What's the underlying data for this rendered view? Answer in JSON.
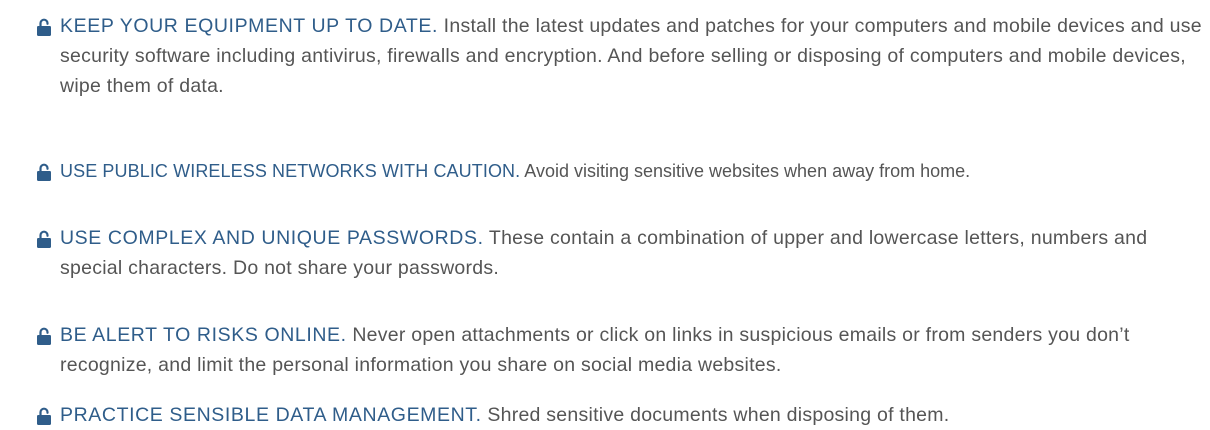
{
  "tips": [
    {
      "icon": "lock-icon",
      "heading": "KEEP YOUR EQUIPMENT UP TO DATE.",
      "body": " Install the latest updates and patches for your computers and mobile devices and use security software including antivirus, firewalls and encryption. And before selling or disposing of computers and mobile devices, wipe them of data."
    },
    {
      "icon": "lock-icon",
      "heading": "USE PUBLIC WIRELESS NETWORKS WITH CAUTION.",
      "body": " Avoid visiting sensitive websites when away from home."
    },
    {
      "icon": "lock-icon",
      "heading": "USE COMPLEX AND UNIQUE PASSWORDS.",
      "body": " These contain a combination of upper and lowercase letters, numbers and special characters. Do not share your passwords."
    },
    {
      "icon": "lock-icon",
      "heading": "BE ALERT TO RISKS ONLINE.",
      "body": " Never open attachments or click on links in suspicious emails or from senders you don’t recognize, and limit the personal information you share on social media websites."
    },
    {
      "icon": "lock-icon",
      "heading": "PRACTICE SENSIBLE DATA MANAGEMENT.",
      "body": " Shred sensitive documents when disposing of them."
    }
  ],
  "colors": {
    "heading": "#2f5d8a",
    "body": "#555555",
    "icon": "#2f5d8a",
    "background": "#ffffff"
  }
}
